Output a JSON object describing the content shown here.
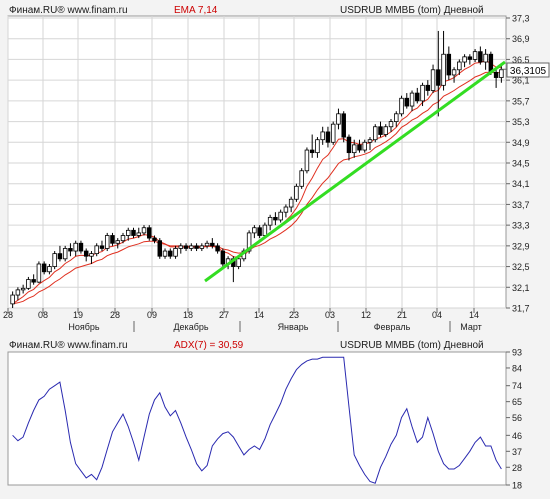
{
  "colors": {
    "background": "#f3f3f3",
    "panel": "#ffffff",
    "grid": "#d6d6d6",
    "frame": "#999999",
    "candle_up": "#ffffff",
    "candle_down": "#000000",
    "candle_outline": "#000000",
    "ema": "#e03020",
    "trendline": "#33dd22",
    "adx_line": "#2a2ab0",
    "last_price_box": "#ffffff",
    "header_text": "#1a1a1a",
    "indicator_text": "#cc0000"
  },
  "main_panel": {
    "source_label": "Финам.RU® www.finam.ru",
    "indicator_label": "EMA 7,14",
    "instrument_label": "USDRUB ММВБ (tom) Дневной",
    "last_price_label": "36,3105"
  },
  "adx_panel": {
    "source_label": "Финам.RU® www.finam.ru",
    "indicator_label": "ADX(7) = 30,59",
    "instrument_label": "USDRUB ММВБ (tom) Дневной"
  },
  "chart_data": [
    {
      "type": "candlestick",
      "title": "USDRUB ММВБ (tom) Дневной",
      "indicator": "EMA 7,14",
      "ylim": [
        31.7,
        37.3
      ],
      "y_ticks": [
        31.7,
        32.1,
        32.5,
        32.9,
        33.3,
        33.7,
        34.1,
        34.5,
        34.9,
        35.3,
        35.7,
        36.1,
        36.5,
        36.9,
        37.3
      ],
      "y_tick_labels": [
        "31,7",
        "32,1",
        "32,5",
        "32,9",
        "33,3",
        "33,7",
        "34,1",
        "34,5",
        "34,9",
        "35,3",
        "35,7",
        "36,1",
        "36,5",
        "36,9",
        "37,3"
      ],
      "x_day_labels": [
        "28",
        "08",
        "19",
        "28",
        "09",
        "18",
        "27",
        "14",
        "23",
        "03",
        "12",
        "21",
        "04",
        "14"
      ],
      "x_month_labels": [
        "Ноябрь",
        "Декабрь",
        "Январь",
        "Февраль",
        "Март"
      ],
      "last_price": 36.3105,
      "grid": true,
      "ohlc": [
        [
          31.78,
          32.02,
          31.7,
          31.95
        ],
        [
          31.95,
          32.1,
          31.85,
          32.05
        ],
        [
          32.05,
          32.15,
          31.98,
          32.08
        ],
        [
          32.08,
          32.3,
          32.05,
          32.25
        ],
        [
          32.25,
          32.35,
          32.15,
          32.2
        ],
        [
          32.2,
          32.6,
          32.18,
          32.55
        ],
        [
          32.55,
          32.6,
          32.35,
          32.4
        ],
        [
          32.4,
          32.55,
          32.35,
          32.5
        ],
        [
          32.5,
          32.8,
          32.45,
          32.75
        ],
        [
          32.75,
          32.9,
          32.6,
          32.65
        ],
        [
          32.65,
          32.9,
          32.6,
          32.85
        ],
        [
          32.85,
          32.95,
          32.7,
          32.8
        ],
        [
          32.8,
          33.0,
          32.7,
          32.95
        ],
        [
          32.95,
          33.0,
          32.75,
          32.8
        ],
        [
          32.8,
          32.85,
          32.6,
          32.7
        ],
        [
          32.7,
          32.8,
          32.55,
          32.75
        ],
        [
          32.75,
          32.95,
          32.7,
          32.9
        ],
        [
          32.9,
          33.0,
          32.8,
          32.85
        ],
        [
          32.85,
          33.15,
          32.8,
          33.1
        ],
        [
          33.1,
          33.15,
          32.9,
          32.95
        ],
        [
          32.95,
          33.05,
          32.85,
          33.0
        ],
        [
          33.0,
          33.15,
          32.95,
          33.1
        ],
        [
          33.1,
          33.25,
          33.0,
          33.2
        ],
        [
          33.2,
          33.25,
          33.05,
          33.1
        ],
        [
          33.1,
          33.25,
          33.05,
          33.15
        ],
        [
          33.15,
          33.3,
          33.1,
          33.25
        ],
        [
          33.25,
          33.3,
          33.0,
          33.05
        ],
        [
          33.05,
          33.1,
          32.95,
          33.0
        ],
        [
          33.0,
          33.05,
          32.65,
          32.7
        ],
        [
          32.7,
          32.85,
          32.65,
          32.8
        ],
        [
          32.8,
          32.85,
          32.65,
          32.7
        ],
        [
          32.7,
          32.9,
          32.65,
          32.85
        ],
        [
          32.85,
          32.95,
          32.75,
          32.9
        ],
        [
          32.9,
          32.95,
          32.8,
          32.85
        ],
        [
          32.85,
          32.95,
          32.8,
          32.9
        ],
        [
          32.9,
          32.95,
          32.8,
          32.85
        ],
        [
          32.85,
          32.95,
          32.8,
          32.9
        ],
        [
          32.9,
          33.0,
          32.85,
          32.95
        ],
        [
          32.95,
          33.05,
          32.85,
          32.9
        ],
        [
          32.9,
          32.95,
          32.75,
          32.8
        ],
        [
          32.8,
          32.85,
          32.5,
          32.55
        ],
        [
          32.55,
          32.7,
          32.45,
          32.65
        ],
        [
          32.65,
          32.7,
          32.2,
          32.5
        ],
        [
          32.5,
          32.7,
          32.45,
          32.65
        ],
        [
          32.65,
          32.85,
          32.6,
          32.8
        ],
        [
          32.8,
          33.2,
          32.75,
          33.15
        ],
        [
          33.15,
          33.3,
          33.05,
          33.25
        ],
        [
          33.25,
          33.3,
          33.05,
          33.1
        ],
        [
          33.1,
          33.35,
          33.05,
          33.3
        ],
        [
          33.3,
          33.5,
          33.2,
          33.45
        ],
        [
          33.45,
          33.55,
          33.3,
          33.4
        ],
        [
          33.4,
          33.6,
          33.35,
          33.55
        ],
        [
          33.55,
          33.7,
          33.45,
          33.65
        ],
        [
          33.65,
          33.85,
          33.55,
          33.8
        ],
        [
          33.8,
          34.1,
          33.75,
          34.05
        ],
        [
          34.05,
          34.4,
          34.0,
          34.35
        ],
        [
          34.35,
          34.8,
          34.3,
          34.75
        ],
        [
          34.75,
          35.05,
          34.6,
          34.7
        ],
        [
          34.7,
          35.0,
          34.6,
          34.95
        ],
        [
          34.95,
          35.2,
          34.85,
          35.1
        ],
        [
          35.1,
          35.2,
          34.8,
          34.9
        ],
        [
          34.9,
          35.3,
          34.85,
          35.25
        ],
        [
          35.25,
          35.55,
          35.15,
          35.45
        ],
        [
          35.45,
          35.5,
          34.9,
          35.0
        ],
        [
          35.0,
          35.05,
          34.55,
          34.7
        ],
        [
          34.7,
          34.95,
          34.6,
          34.85
        ],
        [
          34.85,
          34.95,
          34.7,
          34.75
        ],
        [
          34.75,
          34.95,
          34.7,
          34.9
        ],
        [
          34.9,
          35.0,
          34.75,
          34.95
        ],
        [
          34.95,
          35.25,
          34.9,
          35.2
        ],
        [
          35.2,
          35.3,
          35.0,
          35.05
        ],
        [
          35.05,
          35.25,
          35.0,
          35.2
        ],
        [
          35.2,
          35.35,
          35.1,
          35.3
        ],
        [
          35.3,
          35.5,
          35.2,
          35.45
        ],
        [
          35.45,
          35.8,
          35.4,
          35.75
        ],
        [
          35.75,
          35.85,
          35.55,
          35.6
        ],
        [
          35.6,
          35.9,
          35.5,
          35.85
        ],
        [
          35.85,
          35.95,
          35.65,
          35.7
        ],
        [
          35.7,
          36.05,
          35.6,
          36.0
        ],
        [
          36.0,
          36.1,
          35.8,
          35.9
        ],
        [
          35.9,
          36.4,
          35.85,
          36.3
        ],
        [
          36.3,
          37.05,
          35.4,
          36.0
        ],
        [
          36.0,
          37.05,
          35.9,
          36.6
        ],
        [
          36.6,
          36.75,
          36.1,
          36.2
        ],
        [
          36.2,
          36.35,
          36.05,
          36.3
        ],
        [
          36.3,
          36.5,
          36.2,
          36.45
        ],
        [
          36.45,
          36.6,
          36.35,
          36.55
        ],
        [
          36.55,
          36.6,
          36.4,
          36.5
        ],
        [
          36.5,
          36.7,
          36.45,
          36.65
        ],
        [
          36.65,
          36.75,
          36.4,
          36.45
        ],
        [
          36.45,
          36.7,
          36.3,
          36.6
        ],
        [
          36.6,
          36.65,
          36.2,
          36.25
        ],
        [
          36.25,
          36.3,
          35.95,
          36.15
        ],
        [
          36.15,
          36.4,
          36.05,
          36.3
        ]
      ],
      "series": [
        {
          "name": "EMA 7",
          "values": [
            31.78,
            31.85,
            31.92,
            32.01,
            32.06,
            32.16,
            32.23,
            32.29,
            32.4,
            32.46,
            32.56,
            32.62,
            32.7,
            32.72,
            32.71,
            32.72,
            32.76,
            32.79,
            32.87,
            32.89,
            32.92,
            32.97,
            33.03,
            33.05,
            33.08,
            33.12,
            33.1,
            33.07,
            32.98,
            32.94,
            32.88,
            32.88,
            32.88,
            32.87,
            32.88,
            32.87,
            32.87,
            32.89,
            32.89,
            32.87,
            32.79,
            32.76,
            32.69,
            32.68,
            32.71,
            32.82,
            32.93,
            32.97,
            33.05,
            33.15,
            33.21,
            33.3,
            33.39,
            33.49,
            33.63,
            33.81,
            34.05,
            34.21,
            34.4,
            34.57,
            34.65,
            34.8,
            34.96,
            34.97,
            34.9,
            34.89,
            34.86,
            34.87,
            34.89,
            34.97,
            34.99,
            35.04,
            35.1,
            35.19,
            35.33,
            35.4,
            35.51,
            35.56,
            35.67,
            35.73,
            35.87,
            35.9,
            36.07,
            36.1,
            36.15,
            36.23,
            36.31,
            36.36,
            36.43,
            36.44,
            36.48,
            36.42,
            36.35,
            36.34
          ]
        },
        {
          "name": "EMA 14",
          "values": [
            31.78,
            31.8,
            31.83,
            31.89,
            31.93,
            32.01,
            32.06,
            32.12,
            32.2,
            32.26,
            32.34,
            32.4,
            32.47,
            32.5,
            32.53,
            32.56,
            32.61,
            32.64,
            32.71,
            32.75,
            32.78,
            32.83,
            32.88,
            32.91,
            32.94,
            32.98,
            32.99,
            32.99,
            32.95,
            32.93,
            32.9,
            32.9,
            32.9,
            32.89,
            32.89,
            32.89,
            32.89,
            32.9,
            32.9,
            32.89,
            32.84,
            32.82,
            32.78,
            32.76,
            32.77,
            32.82,
            32.88,
            32.91,
            32.96,
            33.03,
            33.08,
            33.14,
            33.21,
            33.29,
            33.39,
            33.53,
            33.7,
            33.83,
            33.98,
            34.11,
            34.21,
            34.35,
            34.49,
            34.56,
            34.58,
            34.62,
            34.64,
            34.67,
            34.71,
            34.8,
            34.85,
            34.91,
            34.98,
            35.07,
            35.19,
            35.25,
            35.33,
            35.38,
            35.46,
            35.52,
            35.63,
            35.68,
            35.79,
            35.84,
            35.9,
            35.97,
            36.03,
            36.09,
            36.16,
            36.2,
            36.25,
            36.25,
            36.24,
            36.25
          ]
        }
      ]
    },
    {
      "type": "line",
      "title": "USDRUB ММВБ (tom) Дневной",
      "indicator": "ADX(7) = 30,59",
      "ylim": [
        18,
        93
      ],
      "y_ticks": [
        18,
        28,
        37,
        46,
        56,
        65,
        74,
        84,
        93
      ],
      "y_tick_labels": [
        "18",
        "28",
        "37",
        "46",
        "56",
        "65",
        "74",
        "84",
        "93"
      ],
      "grid": false,
      "series": [
        {
          "name": "ADX(7)",
          "values": [
            46,
            43,
            45,
            53,
            60,
            66,
            68,
            72,
            74,
            76,
            60,
            42,
            30,
            26,
            22,
            24,
            21,
            28,
            38,
            48,
            53,
            58,
            51,
            42,
            32,
            45,
            58,
            66,
            70,
            62,
            57,
            60,
            53,
            45,
            38,
            30,
            26,
            29,
            40,
            44,
            47,
            48,
            45,
            40,
            35,
            38,
            40,
            38,
            44,
            52,
            58,
            64,
            72,
            78,
            83,
            86,
            88,
            89,
            89,
            90,
            90,
            90,
            90,
            90,
            62,
            35,
            29,
            24,
            20,
            19,
            28,
            34,
            41,
            46,
            56,
            61,
            51,
            42,
            45,
            56,
            47,
            37,
            30,
            27,
            27,
            29,
            33,
            37,
            42,
            45,
            40,
            40,
            32,
            27
          ]
        }
      ]
    }
  ]
}
